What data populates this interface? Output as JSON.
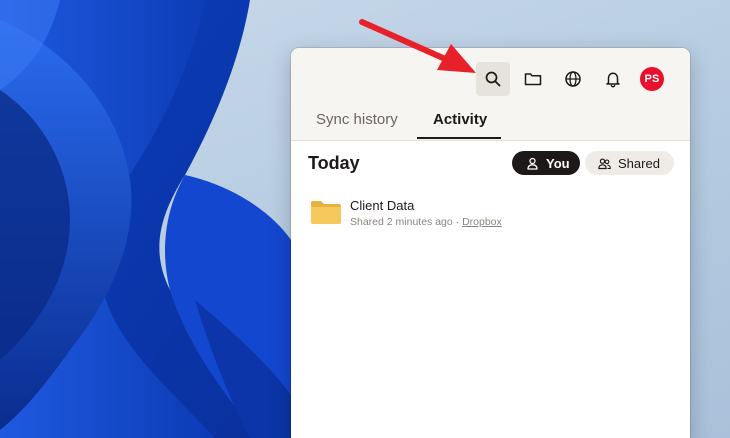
{
  "toolbar": {
    "search_icon": "search-icon",
    "folder_icon": "folder-icon",
    "globe_icon": "globe-icon",
    "bell_icon": "bell-icon",
    "avatar_initials": "PS",
    "avatar_color": "#e8102d"
  },
  "tabs": [
    {
      "label": "Sync history",
      "selected": false
    },
    {
      "label": "Activity",
      "selected": true
    }
  ],
  "main": {
    "section_title": "Today",
    "filters": [
      {
        "label": "You",
        "icon": "person-icon",
        "selected": true
      },
      {
        "label": "Shared",
        "icon": "people-icon",
        "selected": false
      }
    ],
    "items": [
      {
        "name": "Client Data",
        "icon": "folder-icon",
        "meta": "Shared 2 minutes ago · ",
        "meta_link": "Dropbox"
      }
    ]
  },
  "colors": {
    "accent_dark": "#1e1919",
    "header_bg": "#f7f5f2",
    "arrow": "#e8202a",
    "folder": "#f7c85b"
  }
}
